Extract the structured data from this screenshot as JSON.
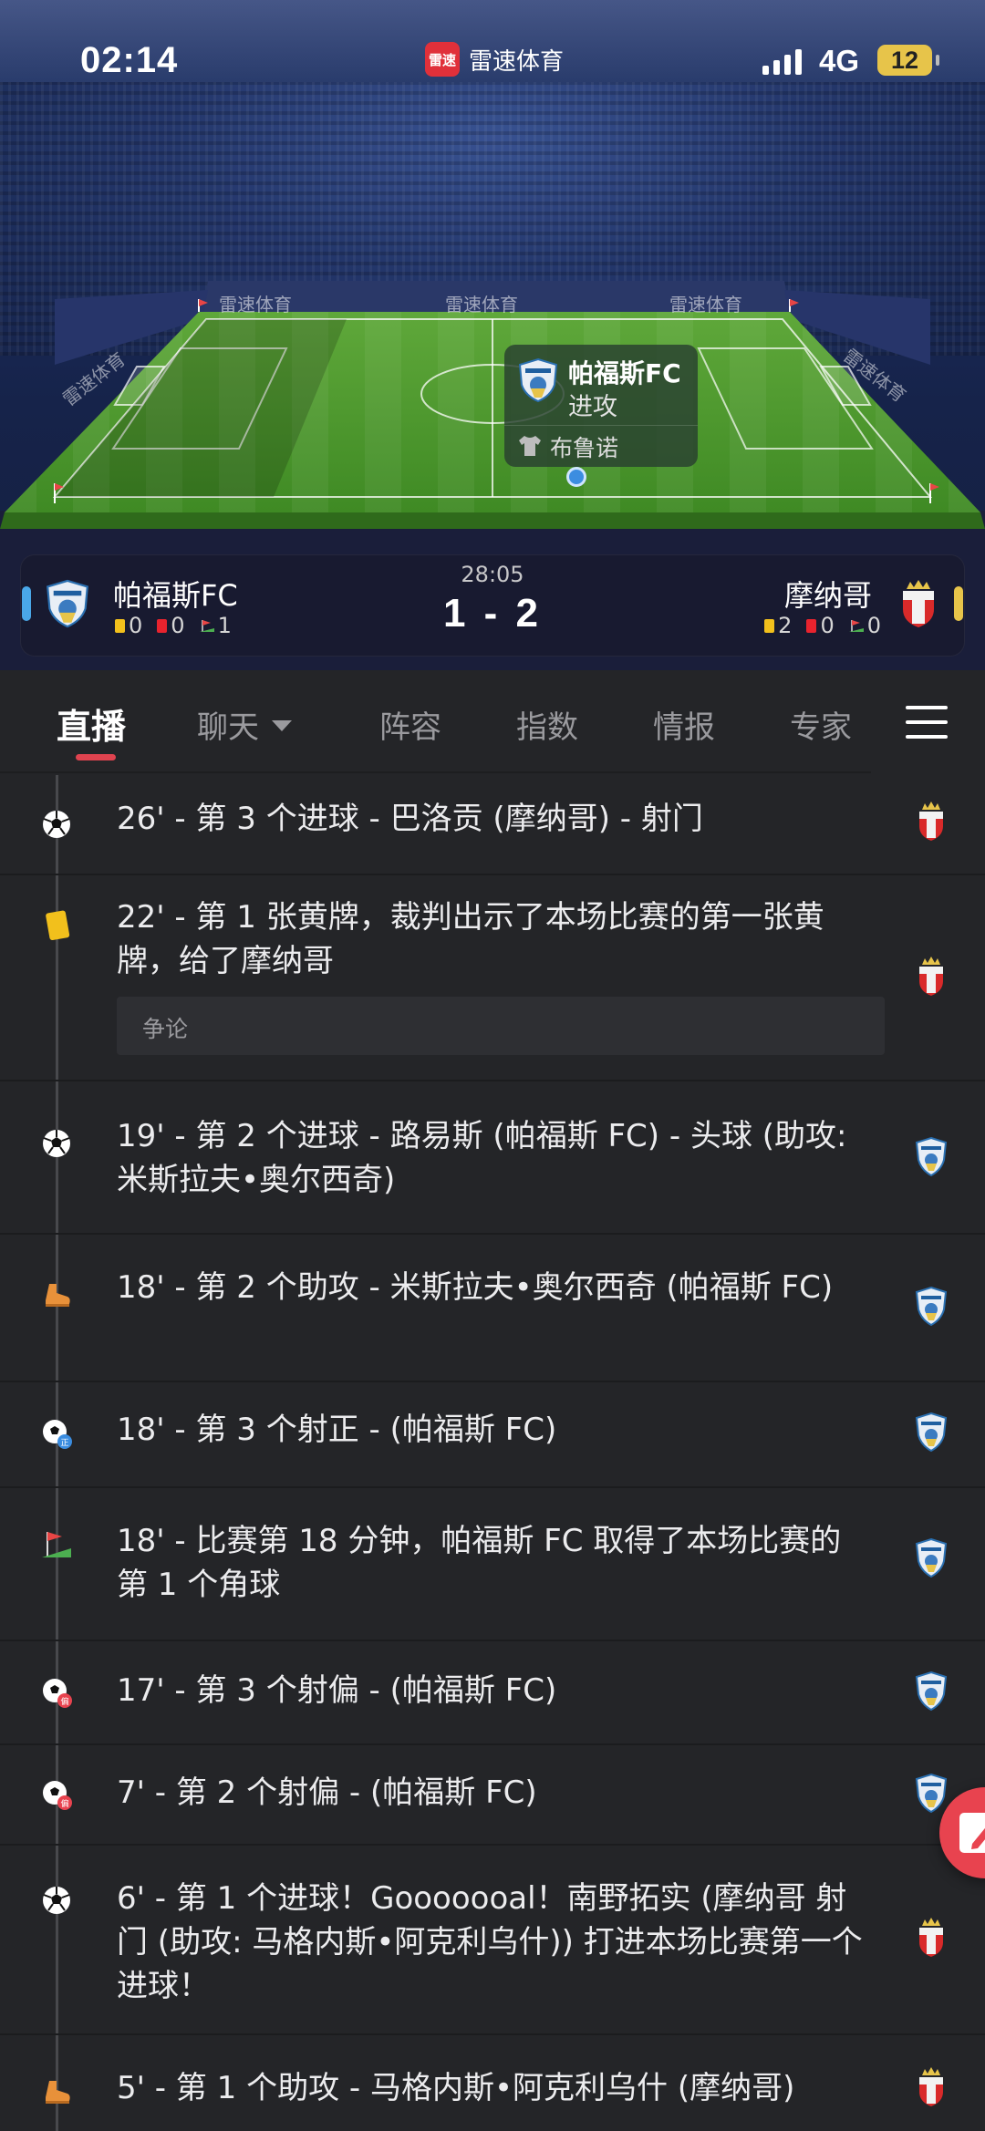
{
  "status_bar": {
    "time": "02:14",
    "network": "4G",
    "battery": "12"
  },
  "app": {
    "name": "雷速体育",
    "logo_text": "雷速"
  },
  "pitch": {
    "ads": [
      "雷速体育",
      "雷速体育",
      "雷速体育",
      "雷速体育",
      "雷速体育"
    ]
  },
  "attack_popup": {
    "team": "帕福斯FC",
    "action": "进攻",
    "player": "布鲁诺"
  },
  "scoreboard": {
    "clock": "28:05",
    "score": "1 - 2",
    "home": {
      "name": "帕福斯FC",
      "yellow": "0",
      "red": "0",
      "corners": "1",
      "color": "#4aa8e8"
    },
    "away": {
      "name": "摩纳哥",
      "yellow": "2",
      "red": "0",
      "corners": "0",
      "color": "#e7c44a"
    }
  },
  "tabs": [
    {
      "label": "直播",
      "active": true
    },
    {
      "label": "聊天",
      "active": false
    },
    {
      "label": "阵容",
      "active": false
    },
    {
      "label": "指数",
      "active": false
    },
    {
      "label": "情报",
      "active": false
    },
    {
      "label": "专家",
      "active": false
    }
  ],
  "events": [
    {
      "icon": "ball-icon",
      "team": "away",
      "text": "26' - 第 3 个进球 - 巴洛贡 (摩纳哥) - 射门"
    },
    {
      "icon": "yellow-card-icon",
      "team": "away",
      "text": "22' - 第 1 张黄牌，裁判出示了本场比赛的第一张黄牌，给了摩纳哥",
      "tag": "争论"
    },
    {
      "icon": "ball-icon",
      "team": "home",
      "text": "19' - 第 2 个进球 - 路易斯 (帕福斯 FC) - 头球 (助攻: 米斯拉夫•奥尔西奇)"
    },
    {
      "icon": "boot-icon",
      "team": "home",
      "text": "18' - 第 2 个助攻 - 米斯拉夫•奥尔西奇 (帕福斯 FC)"
    },
    {
      "icon": "shot-on-target-icon",
      "team": "home",
      "text": "18' - 第 3 个射正 - (帕福斯 FC)"
    },
    {
      "icon": "corner-flag-icon",
      "team": "home",
      "text": "18' - 比赛第 18 分钟，帕福斯 FC 取得了本场比赛的第 1 个角球"
    },
    {
      "icon": "shot-off-target-icon",
      "team": "home",
      "text": "17' - 第 3 个射偏 - (帕福斯 FC)"
    },
    {
      "icon": "shot-off-target-icon",
      "team": "home",
      "text": "7' - 第 2 个射偏 - (帕福斯 FC)"
    },
    {
      "icon": "ball-icon",
      "team": "away",
      "text": "6' - 第 1 个进球！Gooooooal！南野拓实 (摩纳哥 射门 (助攻: 马格内斯•阿克利乌什)) 打进本场比赛第一个进球！"
    },
    {
      "icon": "boot-icon",
      "team": "away",
      "text": "5' - 第 1 个助攻 - 马格内斯•阿克利乌什 (摩纳哥)"
    }
  ]
}
